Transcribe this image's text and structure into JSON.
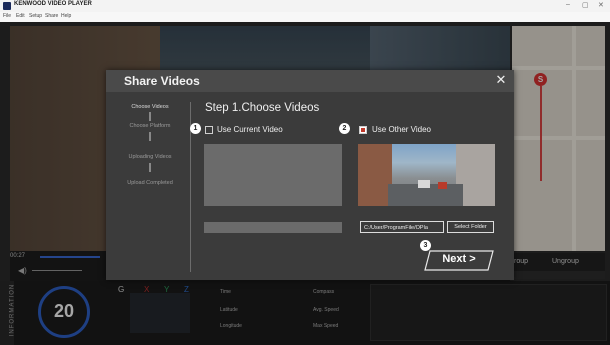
{
  "window": {
    "title": "KENWOOD VIDEO PLAYER",
    "menu": [
      "File",
      "Edit",
      "Setup",
      "Share",
      "Help"
    ],
    "controls": [
      "–",
      "▢",
      "✕"
    ]
  },
  "player": {
    "time": "00:27"
  },
  "right_panel": {
    "group_label": "roup",
    "ungroup_label": "Ungroup"
  },
  "info_panel": {
    "side_label": "INFORMATION",
    "speed": "20",
    "axes": [
      "G",
      "X",
      "Y",
      "Z"
    ],
    "fields": [
      "Time",
      "Latitude",
      "Longitude",
      "Compass",
      "Avg. Speed",
      "Max Speed"
    ]
  },
  "modal": {
    "title": "Share Videos",
    "close_icon": "close-icon",
    "steps": [
      "Choose Videos",
      "Choose Platform",
      "Uploading Videos",
      "Upload Completed"
    ],
    "active_step": 0,
    "heading": "Step 1.Choose Videos",
    "option_current": {
      "badge": "1",
      "label": "Use Current Video",
      "checked": false
    },
    "option_other": {
      "badge": "2",
      "label": "Use Other Video",
      "checked": true
    },
    "path_value": "C:/User/ProgramFile/OPla",
    "select_folder_label": "Select Folder",
    "next_badge": "3",
    "next_label": "Next >"
  },
  "colors": {
    "accent_blue": "#2e61c9",
    "check_red": "#c0392b",
    "modal_bg": "#3b3b3b"
  }
}
